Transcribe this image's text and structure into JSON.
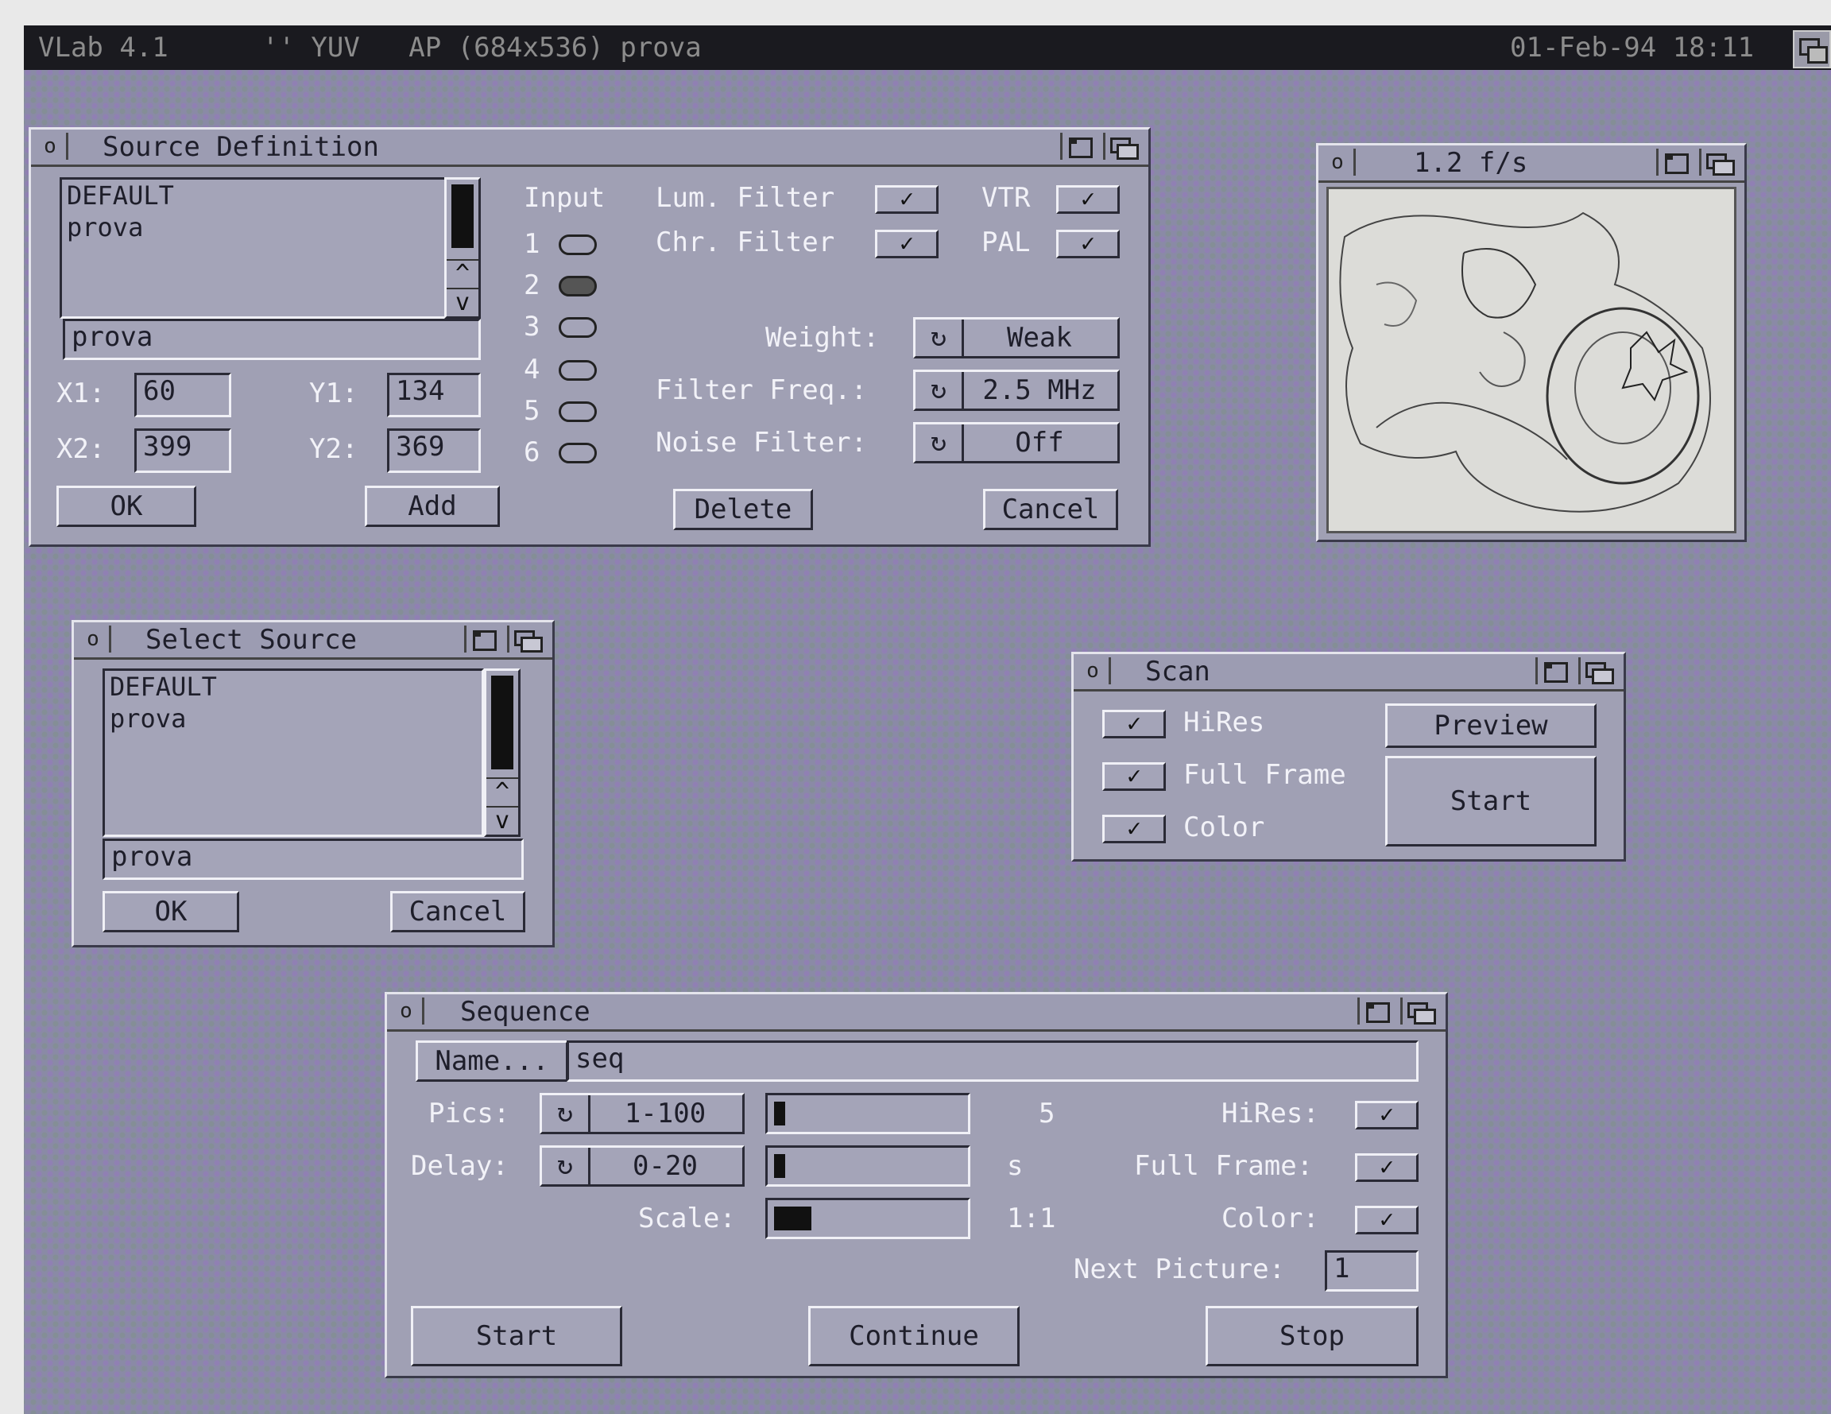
{
  "screen": {
    "left_title": "VLab 4.1",
    "mode_title": "'' YUV   AP (684x536) prova",
    "datetime": "01-Feb-94 18:11"
  },
  "source_definition": {
    "title": "Source Definition",
    "list_items": [
      "DEFAULT",
      "prova"
    ],
    "name_value": "prova",
    "x1_label": "X1:",
    "x1_value": "60",
    "y1_label": "Y1:",
    "y1_value": "134",
    "x2_label": "X2:",
    "x2_value": "399",
    "y2_label": "Y2:",
    "y2_value": "369",
    "ok": "OK",
    "add": "Add",
    "delete": "Delete",
    "cancel": "Cancel",
    "input_label": "Input",
    "inputs": [
      "1",
      "2",
      "3",
      "4",
      "5",
      "6"
    ],
    "selected_input": "2",
    "lum_filter": "Lum. Filter",
    "chr_filter": "Chr. Filter",
    "vtr": "VTR",
    "pal": "PAL",
    "weight_label": "Weight:",
    "weight_value": "Weak",
    "filter_freq_label": "Filter Freq.:",
    "filter_freq_value": "2.5 MHz",
    "noise_filter_label": "Noise Filter:",
    "noise_filter_value": "Off"
  },
  "preview_window": {
    "title": "1.2 f/s",
    "image_caption": "picture"
  },
  "select_source": {
    "title": "Select Source",
    "list_items": [
      "DEFAULT",
      "prova"
    ],
    "name_value": "prova",
    "ok": "OK",
    "cancel": "Cancel"
  },
  "scan": {
    "title": "Scan",
    "hires": "HiRes",
    "full_frame": "Full Frame",
    "color": "Color",
    "preview": "Preview",
    "start": "Start"
  },
  "sequence": {
    "title": "Sequence",
    "name_button": "Name...",
    "name_value": "seq",
    "pics_label": "Pics:",
    "pics_range": "1-100",
    "pics_value": "5",
    "pics_level": 0.05,
    "delay_label": "Delay:",
    "delay_range": "0-20",
    "delay_unit": "s",
    "delay_level": 0.04,
    "scale_label": "Scale:",
    "scale_value": "1:1",
    "scale_level": 0.2,
    "hires_label": "HiRes:",
    "full_frame_label": "Full Frame:",
    "color_label": "Color:",
    "next_picture_label": "Next Picture:",
    "next_picture_value": "1",
    "start": "Start",
    "continue": "Continue",
    "stop": "Stop"
  },
  "icons": {
    "check": "✓",
    "cycle": "↻",
    "up": "^",
    "down": "v",
    "close": "o"
  }
}
